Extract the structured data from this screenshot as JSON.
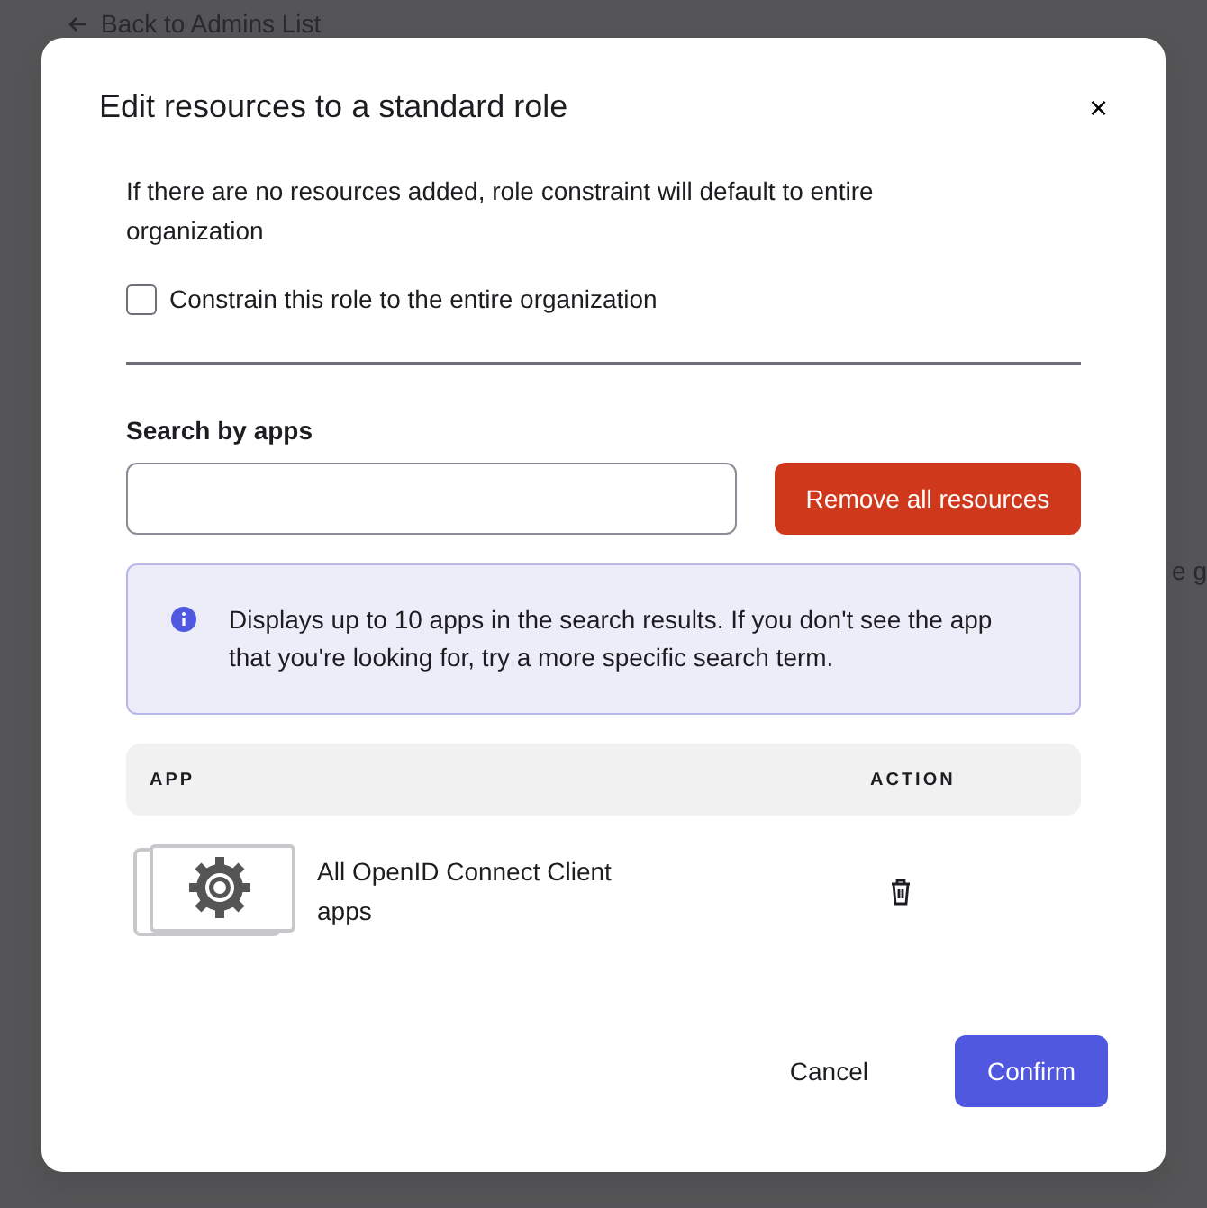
{
  "background": {
    "back_link": "Back to Admins List",
    "fragment": "e g"
  },
  "dialog": {
    "title": "Edit resources to a standard role",
    "close": "×",
    "intro": "If there are no resources added, role constraint will default to entire organization",
    "constrain_checkbox": {
      "label": "Constrain this role to the entire organization",
      "checked": false
    },
    "search": {
      "label": "Search by apps"
    },
    "remove_all_button": "Remove all resources",
    "info": "Displays up to 10 apps in the search results. If you don't see the app that you're looking for, try a more specific search term.",
    "table": {
      "columns": [
        "APP",
        "ACTION"
      ],
      "rows": [
        {
          "app": "All OpenID Connect Client apps"
        }
      ]
    },
    "buttons": {
      "cancel": "Cancel",
      "confirm": "Confirm"
    }
  }
}
